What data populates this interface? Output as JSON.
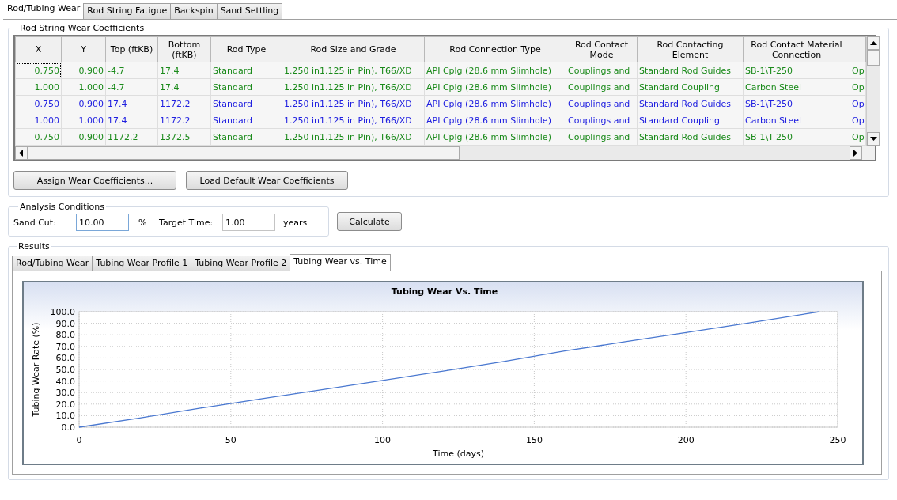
{
  "tabs": [
    {
      "label": "Rod/Tubing Wear",
      "selected": true
    },
    {
      "label": "Rod String Fatigue",
      "selected": false
    },
    {
      "label": "Backspin",
      "selected": false
    },
    {
      "label": "Sand Settling",
      "selected": false
    }
  ],
  "coefficients": {
    "title": "Rod String Wear Coefficients",
    "columns": [
      "X",
      "Y",
      "Top (ftKB)",
      "Bottom (ftKB)",
      "Rod Type",
      "Rod Size and Grade",
      "Rod Connection Type",
      "Rod Contact Mode",
      "Rod Contacting Element",
      "Rod Contact Material Connection",
      ""
    ],
    "rows": [
      {
        "color": "#1a8a1a",
        "focused": true,
        "cells": [
          "0.750",
          "0.900",
          "-4.7",
          "17.4",
          "Standard",
          "1.250 in1.125 in Pin), T66/XD",
          "API Cplg (28.6 mm Slimhole)",
          "Couplings and",
          "Standard Rod Guides",
          "SB-1\\T-250",
          "Op"
        ]
      },
      {
        "color": "#1a8a1a",
        "focused": false,
        "cells": [
          "1.000",
          "1.000",
          "-4.7",
          "17.4",
          "Standard",
          "1.250 in1.125 in Pin), T66/XD",
          "API Cplg (28.6 mm Slimhole)",
          "Couplings and",
          "Standard Coupling",
          "Carbon Steel",
          "Op"
        ]
      },
      {
        "color": "#2020e0",
        "focused": false,
        "cells": [
          "0.750",
          "0.900",
          "17.4",
          "1172.2",
          "Standard",
          "1.250 in1.125 in Pin), T66/XD",
          "API Cplg (28.6 mm Slimhole)",
          "Couplings and",
          "Standard Rod Guides",
          "SB-1\\T-250",
          "Op"
        ]
      },
      {
        "color": "#2020e0",
        "focused": false,
        "cells": [
          "1.000",
          "1.000",
          "17.4",
          "1172.2",
          "Standard",
          "1.250 in1.125 in Pin), T66/XD",
          "API Cplg (28.6 mm Slimhole)",
          "Couplings and",
          "Standard Coupling",
          "Carbon Steel",
          "Op"
        ]
      },
      {
        "color": "#1a8a1a",
        "focused": false,
        "cells": [
          "0.750",
          "0.900",
          "1172.2",
          "1372.5",
          "Standard",
          "1.250 in1.125 in Pin), T66/XD",
          "API Cplg (28.6 mm Slimhole)",
          "Couplings and",
          "Standard Rod Guides",
          "SB-1\\T-250",
          "Op"
        ]
      }
    ],
    "buttons": [
      "Assign Wear Coefficients...",
      "Load Default Wear Coefficients"
    ]
  },
  "analysis": {
    "title": "Analysis Conditions",
    "sand_cut_label": "Sand Cut:",
    "sand_cut": "10.00",
    "sand_cut_unit": "%",
    "target_time_label": "Target Time:",
    "target_time": "1.00",
    "target_time_unit": "years",
    "calculate": "Calculate"
  },
  "results": {
    "title": "Results",
    "tabs": [
      {
        "label": "Rod/Tubing Wear",
        "selected": false
      },
      {
        "label": "Tubing Wear Profile 1",
        "selected": false
      },
      {
        "label": "Tubing Wear Profile 2",
        "selected": false
      },
      {
        "label": "Tubing Wear vs. Time",
        "selected": true
      }
    ],
    "chart_data": {
      "type": "line",
      "title": "Tubing Wear Vs. Time",
      "xlabel": "Time (days)",
      "ylabel": "Tubing Wear Rate (%)",
      "x": [
        0,
        20,
        40,
        60,
        80,
        100,
        120,
        140,
        160,
        180,
        200,
        220,
        244
      ],
      "grid": true,
      "series": [
        {
          "color": "#4a78d0",
          "values": [
            0,
            8,
            16.5,
            24.5,
            32.5,
            40.5,
            48.5,
            57,
            66,
            74,
            82,
            90,
            100
          ]
        }
      ],
      "xlim": [
        0,
        250
      ],
      "ylim": [
        0,
        100
      ],
      "xticks": [
        0,
        50,
        100,
        150,
        200,
        250
      ],
      "yticks": [
        {
          "value": 0,
          "label": "0.0"
        },
        {
          "value": 10,
          "label": "10.0"
        },
        {
          "value": 20,
          "label": "20.0"
        },
        {
          "value": 30,
          "label": "30.0"
        },
        {
          "value": 40,
          "label": "40.0"
        },
        {
          "value": 50,
          "label": "50.0"
        },
        {
          "value": 60,
          "label": "60.0"
        },
        {
          "value": 70,
          "label": "70.0"
        },
        {
          "value": 80,
          "label": "80.0"
        },
        {
          "value": 90,
          "label": "90.0"
        },
        {
          "value": 100,
          "label": "100.0"
        }
      ]
    }
  }
}
